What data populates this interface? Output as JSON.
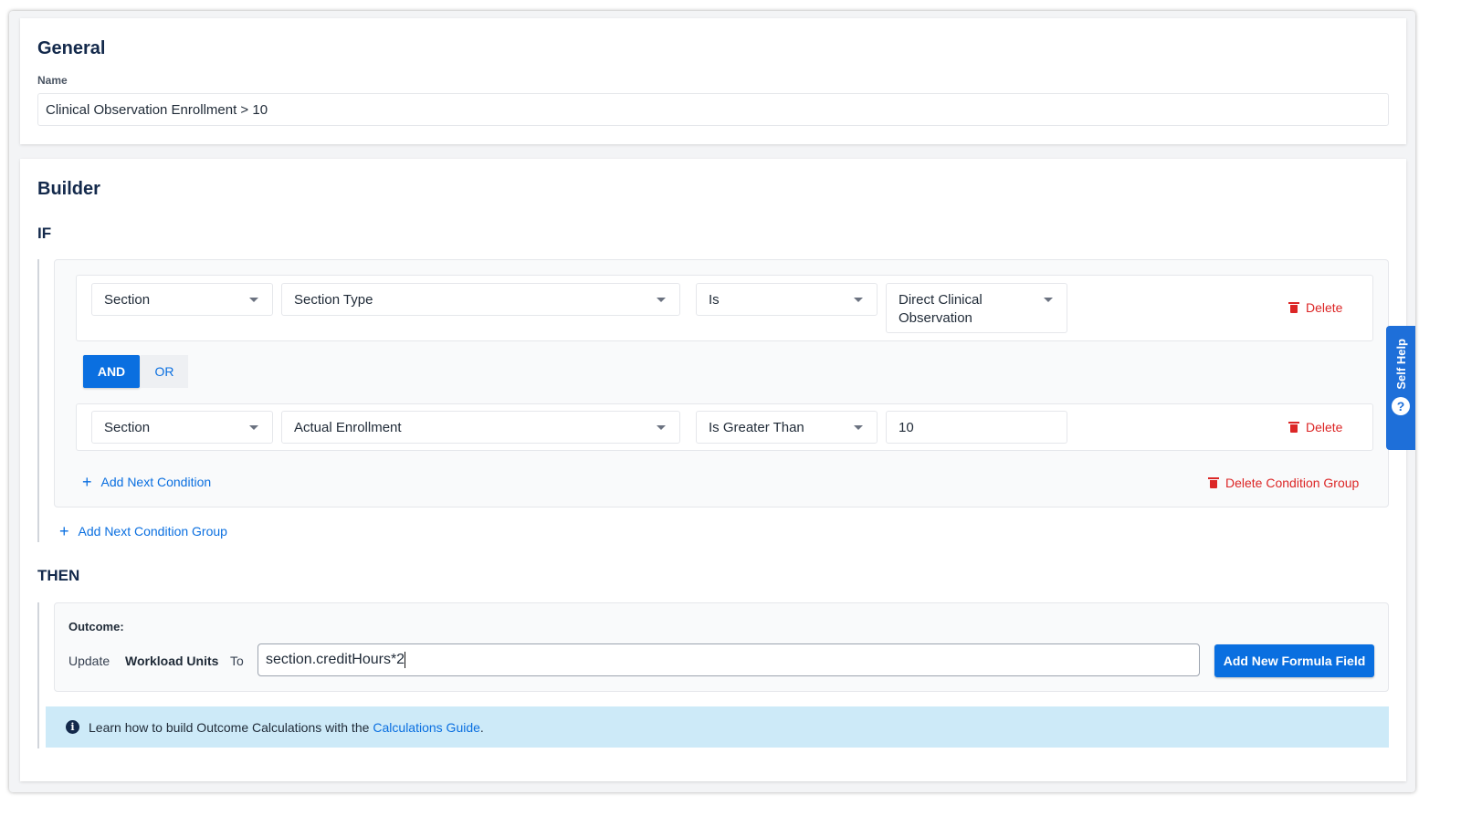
{
  "general": {
    "title": "General",
    "name_label": "Name",
    "name_value": "Clinical Observation Enrollment > 10"
  },
  "builder": {
    "title": "Builder",
    "if_label": "IF",
    "then_label": "THEN",
    "conditions": [
      {
        "field1": "Section",
        "field2": "Section Type",
        "operator": "Is",
        "value": "Direct Clinical Observation",
        "delete_label": "Delete"
      },
      {
        "field1": "Section",
        "field2": "Actual Enrollment",
        "operator": "Is Greater Than",
        "value": "10",
        "delete_label": "Delete"
      }
    ],
    "logic": {
      "and_label": "AND",
      "or_label": "OR",
      "selected": "AND"
    },
    "add_condition_label": "Add Next Condition",
    "delete_group_label": "Delete Condition Group",
    "add_group_label": "Add Next Condition Group",
    "outcome": {
      "label": "Outcome:",
      "update_label": "Update",
      "field": "Workload Units",
      "to_label": "To",
      "formula_value": "section.creditHours*2",
      "add_formula_button": "Add New Formula Field"
    },
    "info": {
      "text": "Learn how to build Outcome Calculations with the",
      "link": "Calculations Guide",
      "suffix": "."
    }
  },
  "self_help": {
    "label": "Self Help",
    "icon": "?"
  },
  "colors": {
    "primary": "#0a6fe0",
    "danger": "#dc2626",
    "heading": "#13294b",
    "info_bg": "#cdeaf8"
  }
}
